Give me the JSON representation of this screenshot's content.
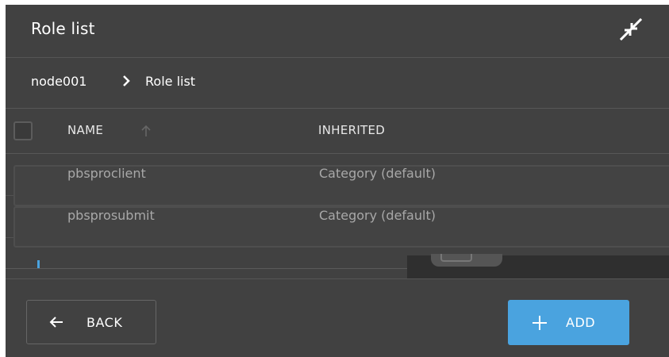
{
  "dialog": {
    "title": "Role list"
  },
  "breadcrumb": {
    "items": [
      "node001",
      "Role list"
    ]
  },
  "table": {
    "columns": [
      {
        "label": "NAME",
        "sort": "ascending"
      },
      {
        "label": "INHERITED"
      }
    ],
    "rows": [
      {
        "name": "pbsproclient",
        "inherited": "Category (default)"
      },
      {
        "name": "pbsprosubmit",
        "inherited": "Category (default)"
      }
    ]
  },
  "footer": {
    "back_label": "BACK",
    "add_label": "ADD"
  },
  "colors": {
    "panel_bg": "#414141",
    "accent": "#4aa3df",
    "muted_text": "#a8a8a8"
  },
  "icons": [
    "collapse-icon",
    "chevron-right-icon",
    "sort-arrow-up-icon",
    "arrow-left-icon",
    "plus-icon"
  ]
}
